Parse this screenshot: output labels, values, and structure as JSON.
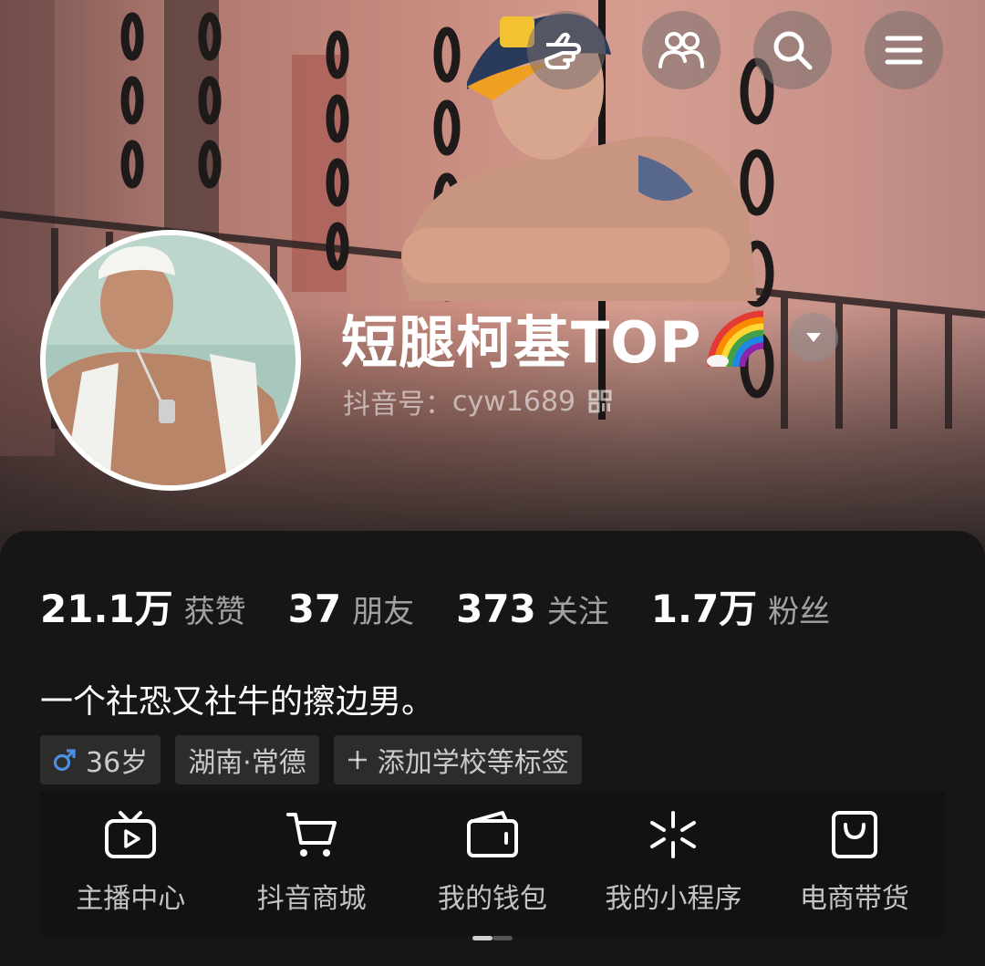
{
  "header": {
    "actions": [
      {
        "icon": "pointing-hand-icon"
      },
      {
        "icon": "friends-icon"
      },
      {
        "icon": "search-icon"
      },
      {
        "icon": "menu-icon"
      }
    ]
  },
  "profile": {
    "name": "短腿柯基TOP",
    "name_emoji": "rainbow-emoji",
    "uid_label": "抖音号：",
    "uid": "cyw1689"
  },
  "stats": [
    {
      "value": "21.1万",
      "label": "获赞"
    },
    {
      "value": "37",
      "label": "朋友"
    },
    {
      "value": "373",
      "label": "关注"
    },
    {
      "value": "1.7万",
      "label": "粉丝"
    }
  ],
  "bio": "一个社恐又社牛的擦边男。",
  "tags": {
    "age": "36岁",
    "location": "湖南·常德",
    "add": "添加学校等标签"
  },
  "shortcuts": [
    {
      "label": "主播中心",
      "icon": "live-tv-icon"
    },
    {
      "label": "抖音商城",
      "icon": "cart-icon"
    },
    {
      "label": "我的钱包",
      "icon": "wallet-icon"
    },
    {
      "label": "我的小程序",
      "icon": "mini-program-icon"
    },
    {
      "label": "电商带货",
      "icon": "shopping-bag-icon"
    }
  ],
  "colors": {
    "background": "#161616",
    "male_icon": "#4a90e2"
  }
}
